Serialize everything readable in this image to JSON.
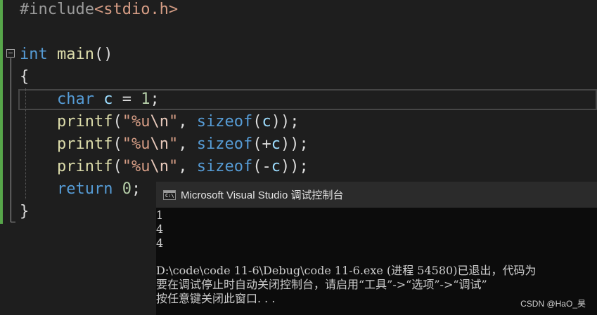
{
  "editor": {
    "include_directive": "#include",
    "include_header": "<stdio.h>",
    "kw_int": "int",
    "main_name": "main",
    "main_parens": "()",
    "open_brace": "{",
    "close_brace": "}",
    "line_char": {
      "kw": "char",
      "var": "c",
      "op": " = ",
      "num": "1",
      "end": ";"
    },
    "printf_lines": [
      {
        "fn": "printf",
        "open": "(",
        "fmt": "\"%u",
        "esc": "\\n",
        "q": "\"",
        "sep": ", ",
        "kw": "sizeof",
        "arg_open": "(",
        "arg_prefix": "",
        "arg": "c",
        "close": "));"
      },
      {
        "fn": "printf",
        "open": "(",
        "fmt": "\"%u",
        "esc": "\\n",
        "q": "\"",
        "sep": ", ",
        "kw": "sizeof",
        "arg_open": "(",
        "arg_prefix": "+",
        "arg": "c",
        "close": "));"
      },
      {
        "fn": "printf",
        "open": "(",
        "fmt": "\"%u",
        "esc": "\\n",
        "q": "\"",
        "sep": ", ",
        "kw": "sizeof",
        "arg_open": "(",
        "arg_prefix": "-",
        "arg": "c",
        "close": "));"
      }
    ],
    "line_return": {
      "kw": "return",
      "num": "0",
      "end": ";"
    }
  },
  "console": {
    "title": "Microsoft Visual Studio 调试控制台",
    "icon_label": "C:\\",
    "output_lines": [
      "1",
      "4",
      "4"
    ],
    "exit_line": "D:\\code\\code 11-6\\Debug\\code 11-6.exe (进程 54580)已退出，代码为",
    "hint_line": "要在调试停止时自动关闭控制台，请启用“工具”->“选项”->“调试”",
    "close_line": "按任意键关闭此窗口. . ."
  },
  "watermark": "CSDN @HaO_昊"
}
